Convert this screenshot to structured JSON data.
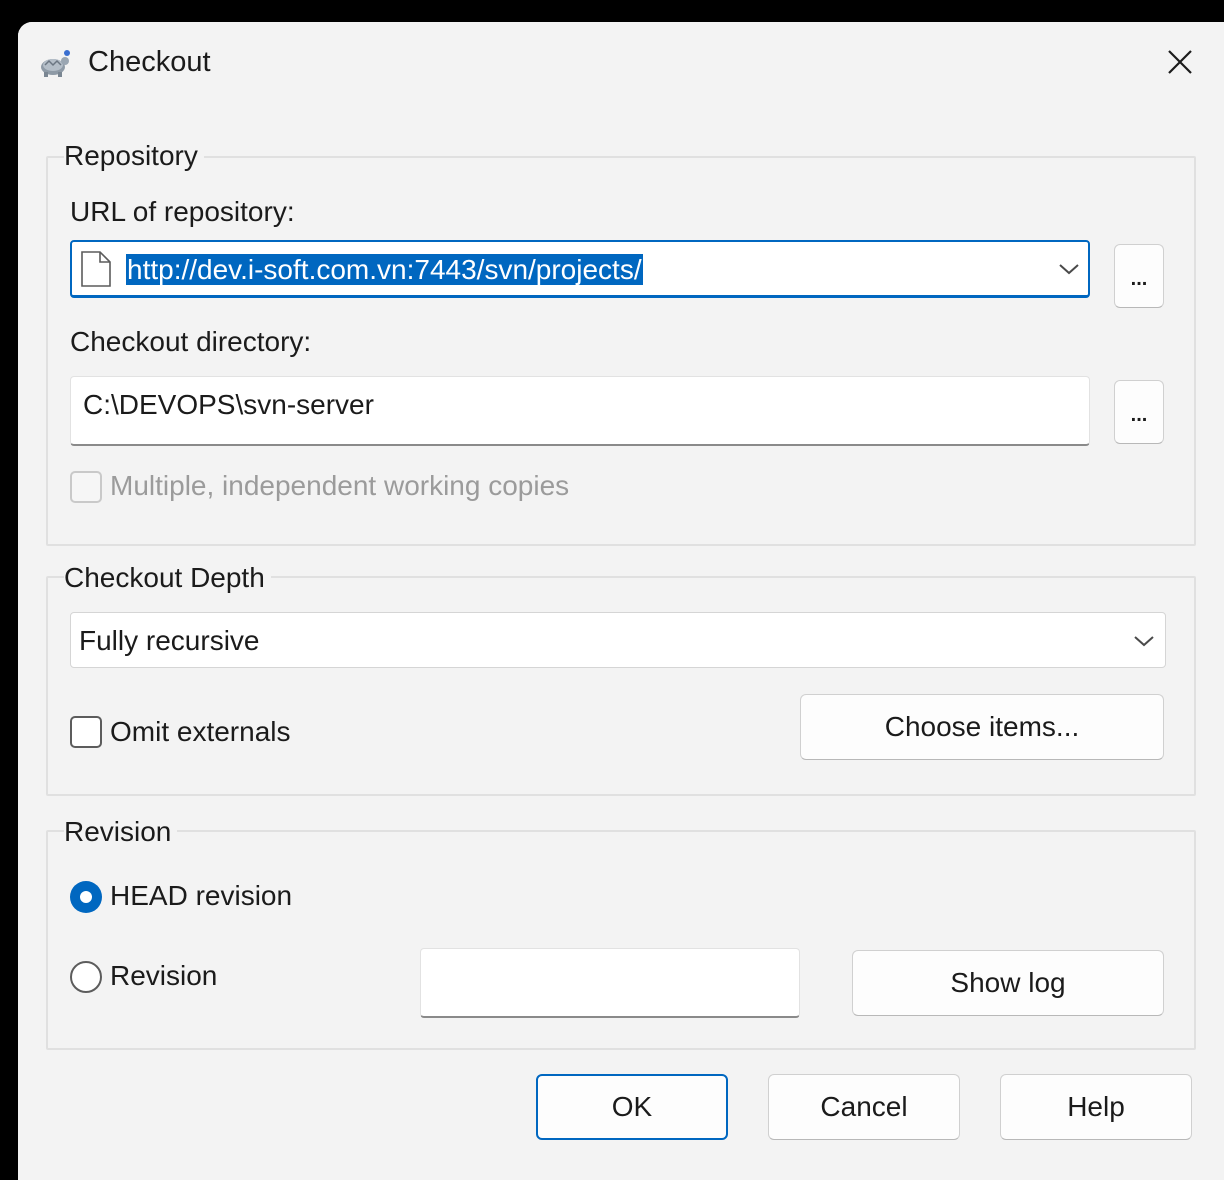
{
  "window": {
    "title": "Checkout",
    "icon": "tortoise-svn-icon",
    "close_icon": "close-icon"
  },
  "repository": {
    "legend": "Repository",
    "url_label": "URL of repository:",
    "url_value": "http://dev.i-soft.com.vn:7443/svn/projects/",
    "url_browse_label": "...",
    "dir_label": "Checkout directory:",
    "dir_value": "C:\\DEVOPS\\svn-server",
    "dir_browse_label": "...",
    "multiple_copies_label": "Multiple, independent working copies",
    "multiple_copies_checked": false,
    "multiple_copies_enabled": false
  },
  "depth": {
    "legend": "Checkout Depth",
    "selected": "Fully recursive",
    "omit_externals_label": "Omit externals",
    "omit_externals_checked": false,
    "choose_items_label": "Choose items..."
  },
  "revision": {
    "legend": "Revision",
    "head_label": "HEAD revision",
    "head_checked": true,
    "revision_label": "Revision",
    "revision_checked": false,
    "revision_value": "",
    "show_log_label": "Show log"
  },
  "footer": {
    "ok_label": "OK",
    "cancel_label": "Cancel",
    "help_label": "Help"
  },
  "colors": {
    "accent": "#0067c0",
    "dialog_bg": "#f3f3f3",
    "outer_bg": "#000000"
  }
}
